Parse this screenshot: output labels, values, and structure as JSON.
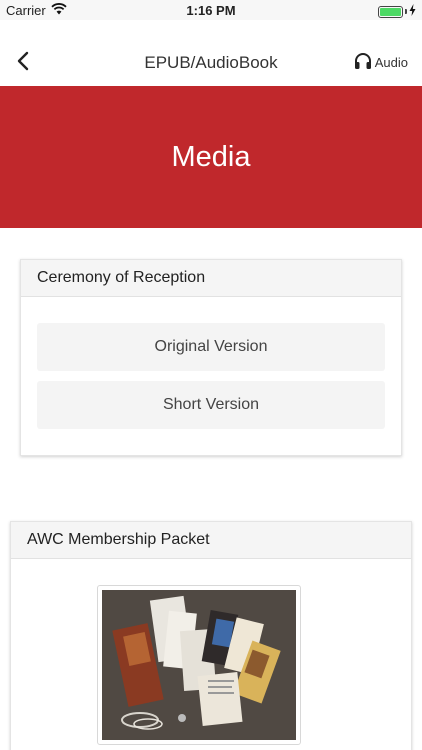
{
  "status_bar": {
    "carrier": "Carrier",
    "time": "1:16 PM",
    "wifi_icon": "wifi-icon",
    "battery_icon": "battery-icon",
    "charging_icon": "bolt-icon"
  },
  "nav": {
    "back_icon": "chevron-left-icon",
    "title": "EPUB/AudioBook",
    "audio_icon": "headphones-icon",
    "audio_label": "Audio"
  },
  "banner": {
    "title": "Media",
    "color": "#c0282c"
  },
  "reception": {
    "title": "Ceremony of Reception",
    "buttons": [
      "Original Version",
      "Short Version"
    ]
  },
  "packet": {
    "title": "AWC Membership Packet"
  },
  "colors": {
    "accent": "#c0282c",
    "battery": "#4cd964",
    "card_header": "#f5f5f5",
    "button_bg": "#f4f4f4"
  }
}
